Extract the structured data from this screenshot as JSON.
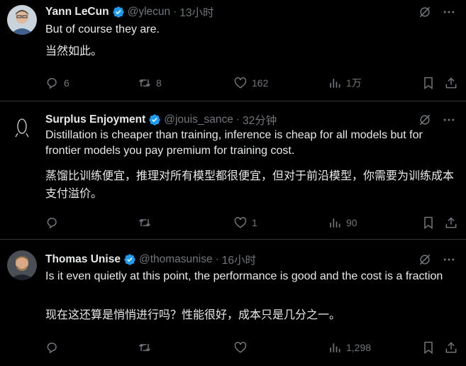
{
  "colors": {
    "background": "#000000",
    "text": "#e7e9ea",
    "muted": "#71767b",
    "verified": "#1d9bf0",
    "divider": "#2f3336"
  },
  "tweets": [
    {
      "name": "Yann LeCun",
      "handle": "@ylecun",
      "dot": "·",
      "time": "13小时",
      "text_en": "But of course they are.",
      "text_zh": "当然如此。",
      "replies": "6",
      "retweets": "8",
      "likes": "162",
      "views": "1万",
      "avatar_icon": "profile-photo"
    },
    {
      "name": "Surplus Enjoyment",
      "handle": "@jouis_sance",
      "dot": "·",
      "time": "32分钟",
      "text_en": "Distillation is cheaper than training, inference is cheap for all models but for frontier models you pay premium for training cost.",
      "text_zh": "蒸馏比训练便宜，推理对所有模型都很便宜，但对于前沿模型，你需要为训练成本支付溢价。",
      "replies": "",
      "retweets": "",
      "likes": "1",
      "views": "90",
      "avatar_icon": "logo-avatar"
    },
    {
      "name": "Thomas Unise",
      "handle": "@thomasunise",
      "dot": "·",
      "time": "16小时",
      "text_en": "Is it even quietly at this point, the performance is good and the cost is a fraction",
      "text_zh": "现在这还算是悄悄进行吗？性能很好，成本只是几分之一。",
      "replies": "",
      "retweets": "",
      "likes": "",
      "views": "1,298",
      "avatar_icon": "profile-photo"
    }
  ],
  "icons": [
    "grok-icon",
    "more-icon",
    "reply-icon",
    "retweet-icon",
    "like-icon",
    "views-icon",
    "bookmark-icon",
    "share-icon",
    "verified-badge-icon"
  ]
}
